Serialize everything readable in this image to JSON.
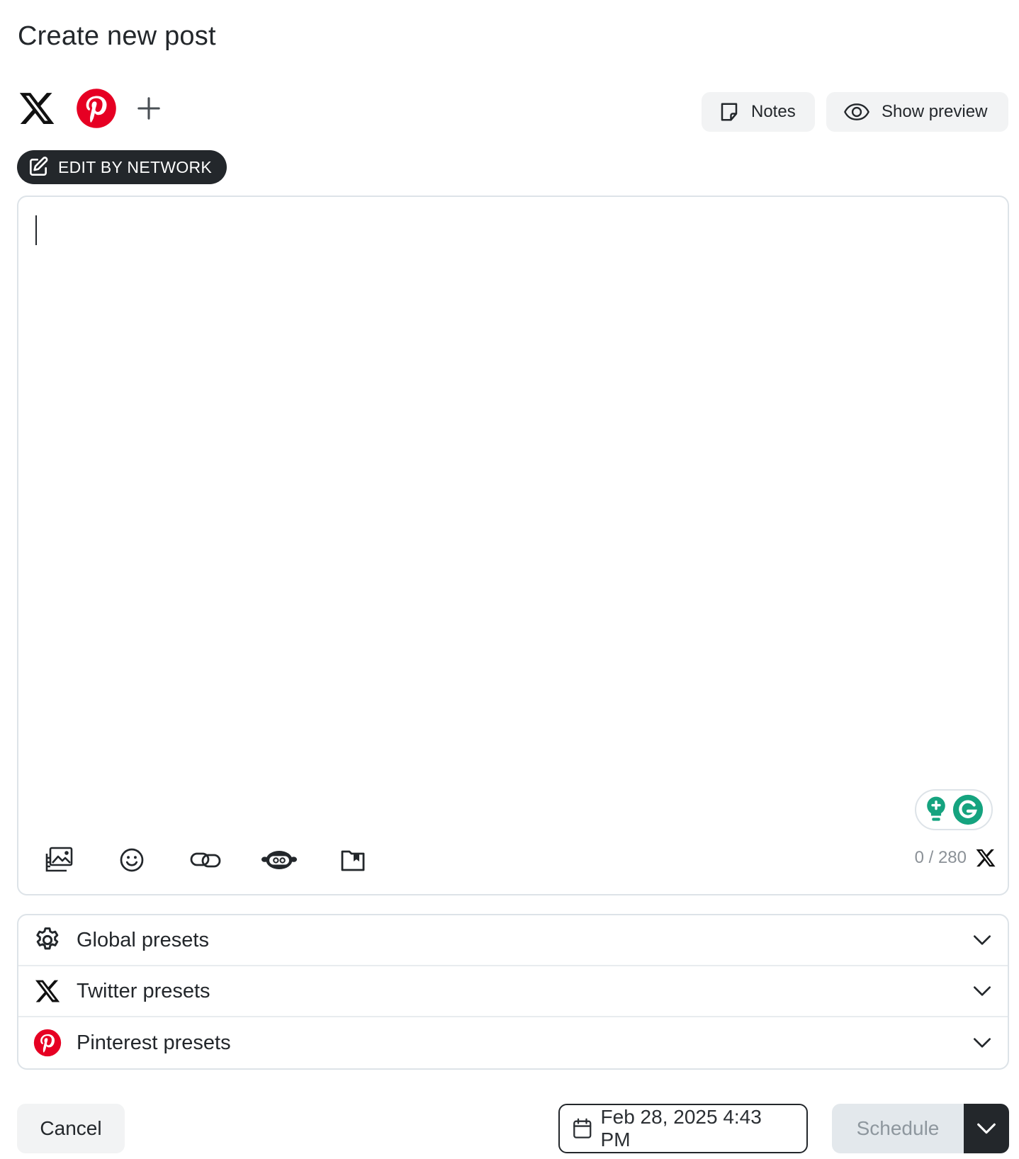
{
  "header": {
    "title": "Create new post"
  },
  "networks": {
    "items": [
      "x-logo-icon",
      "pinterest-logo-icon",
      "plus-icon"
    ],
    "colors": {
      "x": "#111111",
      "pinterest": "#e60023"
    }
  },
  "toolbar_top": {
    "notes_label": "Notes",
    "preview_label": "Show preview"
  },
  "edit_by_network": {
    "label": "EDIT BY NETWORK"
  },
  "editor": {
    "value": "",
    "counter": "0 / 280",
    "tools": [
      "media-icon",
      "emoji-icon",
      "link-icon",
      "ai-assistant-icon",
      "library-icon"
    ]
  },
  "presets": {
    "items": [
      {
        "label": "Global presets",
        "icon": "gear-icon"
      },
      {
        "label": "Twitter presets",
        "icon": "x-logo-icon"
      },
      {
        "label": "Pinterest presets",
        "icon": "pinterest-logo-icon"
      }
    ]
  },
  "footer": {
    "cancel_label": "Cancel",
    "date_value": "Feb 28, 2025 4:43 PM",
    "schedule_label": "Schedule"
  },
  "colors": {
    "dark": "#23272b",
    "muted": "#8e979e",
    "border": "#dde3e8",
    "grammarly": "#15a37f"
  }
}
